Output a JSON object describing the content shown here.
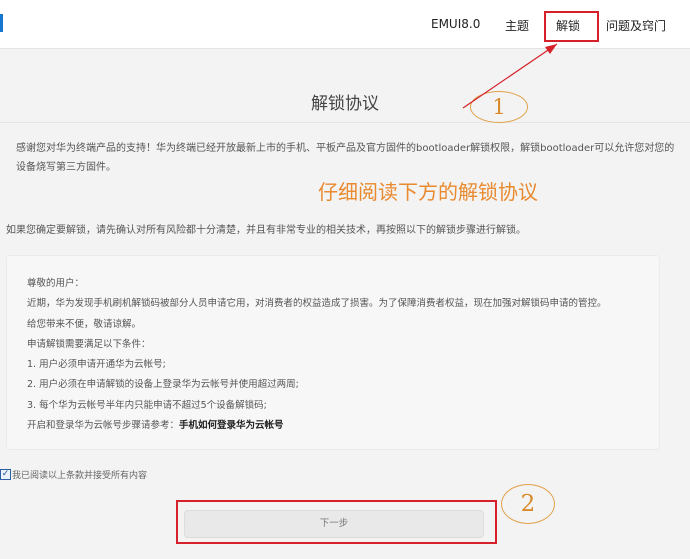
{
  "nav": {
    "items": [
      "EMUI8.0",
      "主题",
      "解锁",
      "问题及窍门"
    ],
    "active_index": 2
  },
  "page": {
    "title": "解锁协议",
    "intro_lines": [
      "感谢您对华为终端产品的支持！华为终端已经开放最新上市的手机、平板产品及官方固件的bootloader解锁权限，解锁bootloader可以允许您对您的",
      "设备烧写第三方固件。"
    ],
    "confirm_text": "如果您确定要解锁，请先确认对所有风险都十分清楚，并且有非常专业的相关技术，再按照以下的解锁步骤进行解锁。"
  },
  "notice": {
    "lines": [
      "尊敬的用户：",
      "近期，华为发现手机刷机解锁码被部分人员申请它用，对消费者的权益造成了损害。为了保障消费者权益，现在加强对解锁码申请的管控。",
      "给您带来不便，敬请谅解。",
      "申请解锁需要满足以下条件：",
      "1. 用户必须申请开通华为云帐号;",
      "2. 用户必须在申请解锁的设备上登录华为云帐号并使用超过两周;",
      "3. 每个华为云帐号半年内只能申请不超过5个设备解锁码;"
    ],
    "last_line_prefix": "开启和登录华为云帐号步骤请参考：",
    "last_line_link": "手机如何登录华为云帐号"
  },
  "agreement": {
    "checked": true,
    "check_mark": "✓",
    "label": "我已阅读以上条款并接受所有内容"
  },
  "next_button": {
    "label": "下一步"
  },
  "annotations": {
    "overlay_text": "仔细阅读下方的解锁协议",
    "circle1": "1",
    "circle2": "2",
    "highlight_color": "#d6202a",
    "annotation_color": "#e98a2f"
  }
}
